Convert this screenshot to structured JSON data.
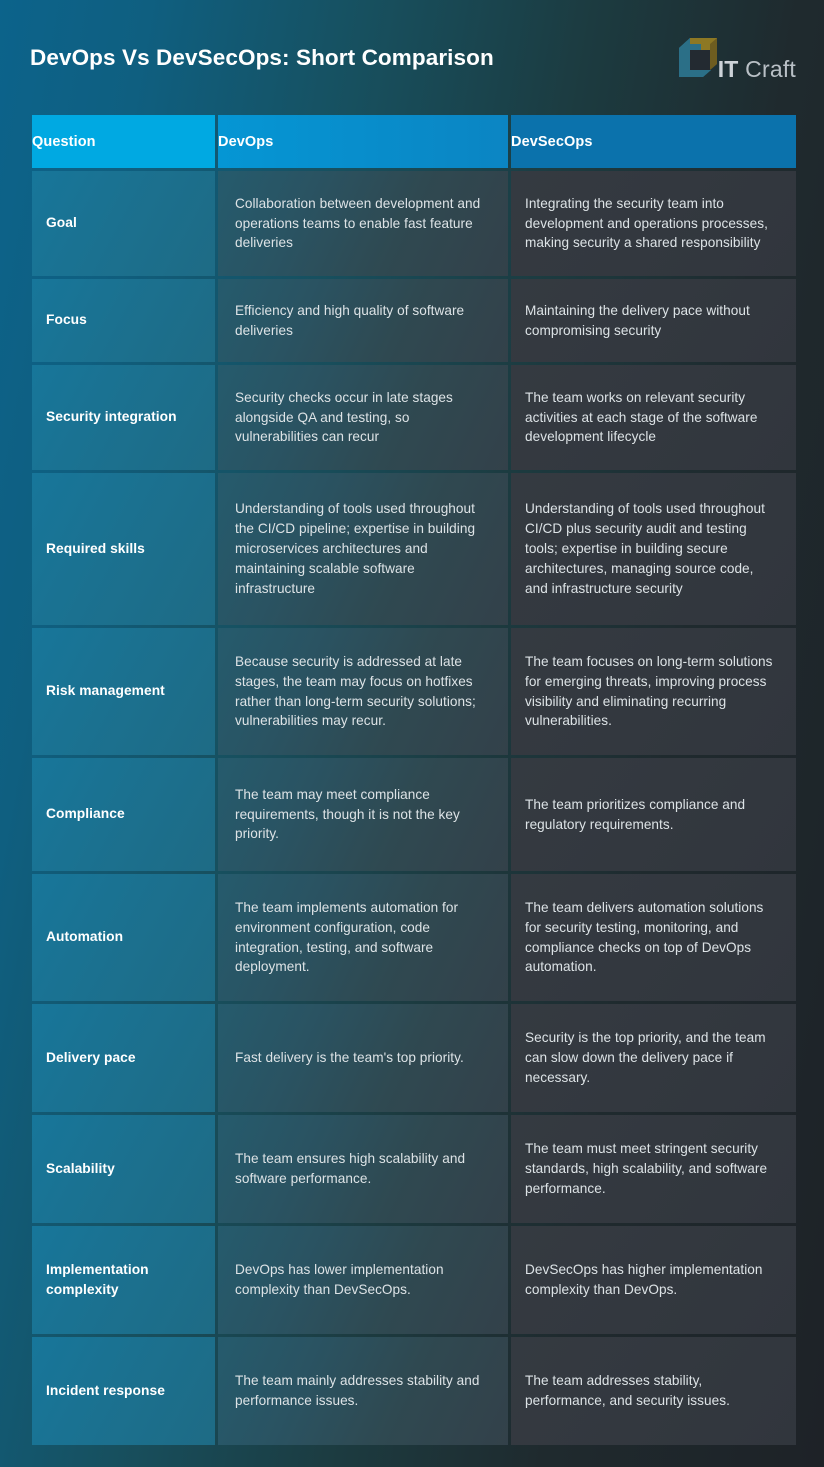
{
  "header": {
    "title": "DevOps Vs DevSecOps: Short Comparison",
    "logo": {
      "icon_name": "it-craft-logo-mark",
      "text_bold": "IT",
      "text_regular": "Craft"
    }
  },
  "table": {
    "columns": [
      "Question",
      "DevOps",
      "DevSecOps"
    ],
    "rows": [
      {
        "question": "Goal",
        "devops": "Collaboration between development and operations teams to enable fast feature deliveries",
        "devsecops": "Integrating the security team into development and operations processes, making security a shared responsibility"
      },
      {
        "question": "Focus",
        "devops": "Efficiency and high quality of software deliveries",
        "devsecops": "Maintaining the delivery pace without compromising security"
      },
      {
        "question": "Security integration",
        "devops": "Security checks occur in late stages alongside QA and testing, so vulnerabilities can recur",
        "devsecops": "The team works on relevant security activities at each stage of the software development lifecycle"
      },
      {
        "question": "Required skills",
        "devops": "Understanding of tools used throughout the CI/CD pipeline; expertise in building microservices architectures and maintaining scalable software infrastructure",
        "devsecops": "Understanding of tools used throughout CI/CD plus security audit and testing tools; expertise in building secure architectures, managing source code, and infrastructure security"
      },
      {
        "question": "Risk management",
        "devops": "Because security is addressed at late stages, the team may focus on hotfixes rather than long-term security solutions; vulnerabilities may recur.",
        "devsecops": "The team focuses on long-term solutions for emerging threats, improving process visibility and eliminating recurring vulnerabilities."
      },
      {
        "question": "Compliance",
        "devops": "The team may meet compliance requirements, though it is not the key priority.",
        "devsecops": "The team prioritizes compliance and regulatory requirements."
      },
      {
        "question": "Automation",
        "devops": "The team implements automation for environment configuration, code integration, testing, and software deployment.",
        "devsecops": "The team delivers automation solutions for security testing, monitoring, and compliance checks on top of DevOps automation."
      },
      {
        "question": "Delivery pace",
        "devops": "Fast delivery is the team's top priority.",
        "devsecops": "Security is the top priority, and the team can slow down the delivery pace if necessary."
      },
      {
        "question": "Scalability",
        "devops": "The team ensures high scalability and software performance.",
        "devsecops": "The team must meet stringent security standards, high scalability, and software performance."
      },
      {
        "question": "Implementation complexity",
        "devops": "DevOps has lower implementation complexity than DevSecOps.",
        "devsecops": "DevSecOps has higher implementation complexity than DevOps."
      },
      {
        "question": "Incident response",
        "devops": "The team mainly addresses stability and performance issues.",
        "devsecops": "The team addresses stability, performance, and security issues."
      }
    ]
  },
  "colors": {
    "header_question": "#00a9e2",
    "header_devops": "#0790cd",
    "header_devsecops": "#0b72ac",
    "question_column": "#1b7190",
    "devops_column": "#2f4951",
    "devsecops_column": "#33383f",
    "logo_teal": "#2b6f87",
    "logo_gold": "#8d7824",
    "background_left": "#0c638b",
    "background_right": "#1e2227",
    "title_text": "#ffffff"
  }
}
